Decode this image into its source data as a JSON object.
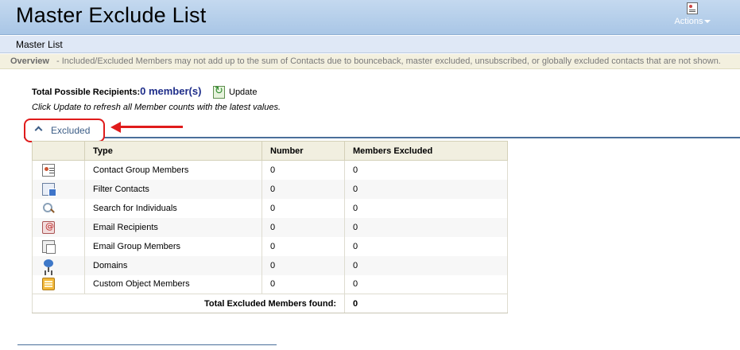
{
  "header": {
    "title": "Master Exclude List",
    "actions_label": "Actions"
  },
  "subbar": {
    "label": "Master List"
  },
  "overview": {
    "title": "Overview",
    "text": "-  Included/Excluded Members may not add up to the sum of Contacts due to bounceback, master excluded, unsubscribed, or globally excluded contacts that are not shown."
  },
  "recipients": {
    "label": "Total Possible Recipients:",
    "count": "0 member(s)",
    "update_label": "Update",
    "hint": "Click Update to refresh all Member counts with the latest values."
  },
  "section": {
    "label": "Excluded"
  },
  "table": {
    "columns": [
      "Type",
      "Number",
      "Members Excluded"
    ],
    "rows": [
      {
        "icon": "contact-group-icon",
        "type": "Contact Group Members",
        "number": "0",
        "excluded": "0"
      },
      {
        "icon": "filter-contacts-icon",
        "type": "Filter Contacts",
        "number": "0",
        "excluded": "0"
      },
      {
        "icon": "magnifier-icon",
        "type": "Search for Individuals",
        "number": "0",
        "excluded": "0"
      },
      {
        "icon": "email-at-icon",
        "type": "Email Recipients",
        "number": "0",
        "excluded": "0"
      },
      {
        "icon": "email-group-icon",
        "type": "Email Group Members",
        "number": "0",
        "excluded": "0"
      },
      {
        "icon": "domain-network-icon",
        "type": "Domains",
        "number": "0",
        "excluded": "0"
      },
      {
        "icon": "custom-object-icon",
        "type": "Custom Object Members",
        "number": "0",
        "excluded": "0"
      }
    ],
    "total_label": "Total Excluded Members found:",
    "total_value": "0"
  },
  "colors": {
    "header_bg": "#b4cde9",
    "annotation_red": "#e01b1b",
    "count_blue": "#1f2e8a",
    "section_blue": "#3c5d86"
  }
}
